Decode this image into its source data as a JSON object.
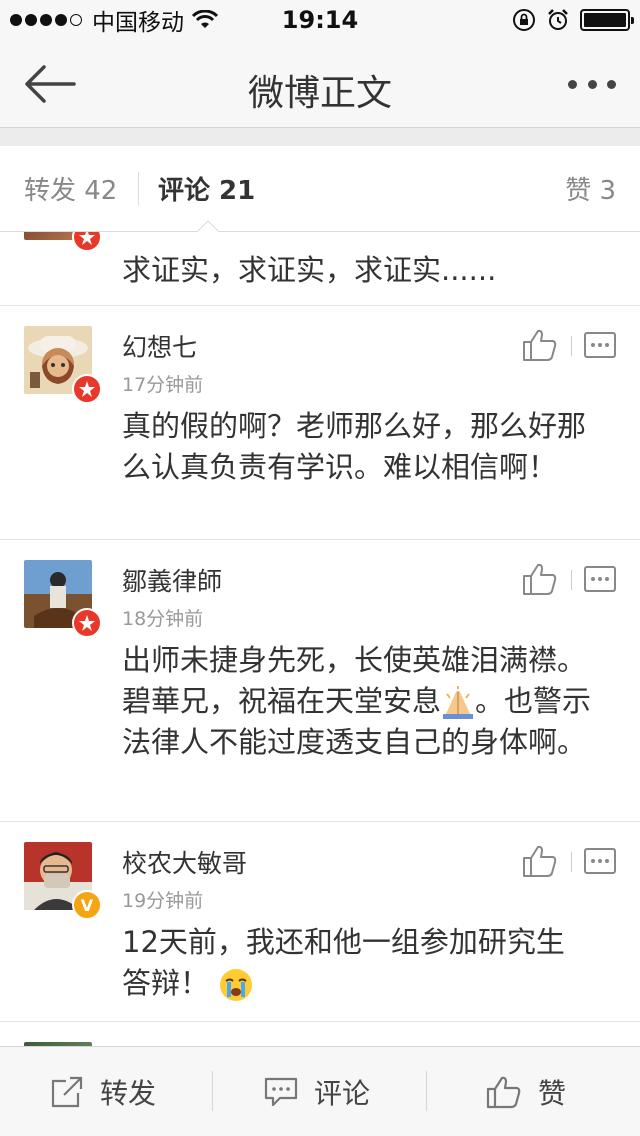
{
  "status_bar": {
    "carrier": "中国移动",
    "time": "19:14"
  },
  "nav": {
    "title": "微博正文"
  },
  "tabs": {
    "repost": "转发 42",
    "comment": "评论 21",
    "like": "赞 3"
  },
  "comments": [
    {
      "username": "",
      "time": "",
      "text": "求证实，求证实，求证实......",
      "badge": "red"
    },
    {
      "username": "幻想七",
      "time": "17分钟前",
      "text": "真的假的啊？老师那么好，那么好那么认真负责有学识。难以相信啊！",
      "badge": "red"
    },
    {
      "username": "鄒義律師",
      "time": "18分钟前",
      "text": "出师未捷身先死，长使英雄泪满襟。碧華兄，祝福在天堂安息",
      "text_after": "。也警示法律人不能过度透支自己的身体啊。",
      "emoji": "praying-hands-icon",
      "badge": "red"
    },
    {
      "username": "校农大敏哥",
      "time": "19分钟前",
      "text": "12天前，我还和他一组参加研究生答辩！",
      "emoji": "crying-face-icon",
      "badge": "gold",
      "badge_text": "V"
    }
  ],
  "bottom_bar": {
    "repost": "转发",
    "comment": "评论",
    "like": "赞"
  },
  "colors": {
    "badge_red": "#e8382a",
    "badge_gold": "#f5a412",
    "text_primary": "#333333",
    "text_secondary": "#999999"
  }
}
